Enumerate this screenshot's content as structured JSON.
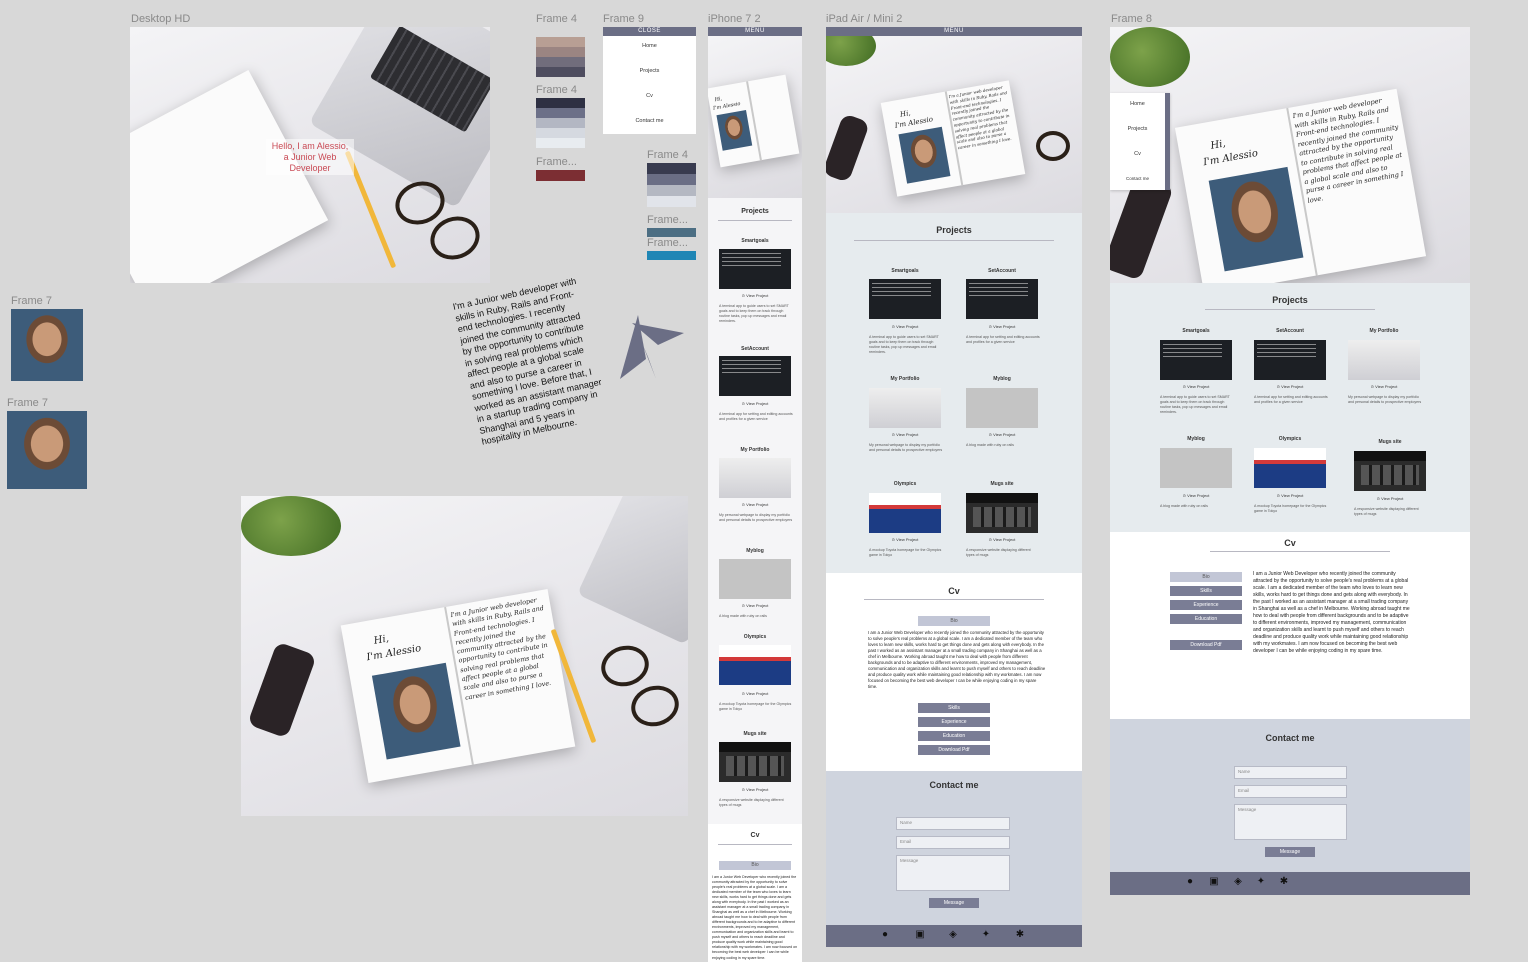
{
  "frames": {
    "desktop_hd": "Desktop HD",
    "frame4_a": "Frame 4",
    "frame4_b": "Frame 4",
    "frame4_c": "Frame 4",
    "frame_trunc_a": "Frame...",
    "frame_trunc_b": "Frame...",
    "frame_trunc_c": "Frame...",
    "frame9": "Frame 9",
    "iphone": "iPhone 7 2",
    "ipad": "iPad Air / Mini 2",
    "frame8": "Frame 8",
    "frame7_a": "Frame 7",
    "frame7_b": "Frame 7"
  },
  "colors": {
    "palette1": [
      "#b89f94",
      "#9b8582",
      "#716d7c",
      "#4e4d5f"
    ],
    "palette2": [
      "#2e3043",
      "#6c7088",
      "#b3b7c3",
      "#d5d9e0",
      "#e8ecf0"
    ],
    "palette3": [
      "#7c2e33"
    ],
    "palette4": [
      "#383b4f",
      "#6a6e85",
      "#b4b8c2",
      "#e1e4ea"
    ],
    "palette5": [
      "#4c6e83"
    ],
    "palette6": [
      "#1f86b5"
    ]
  },
  "hero": {
    "greeting": "Hello, I am Alessio, a Junior Web Developer",
    "hi": "Hi,",
    "name": "I'm Alessio",
    "notebook_text": "I'm a Junior web developer with skills in Ruby, Rails and Front-end technologies. I recently joined the community attracted by the opportunity to contribute in solving real problems that affect people at a global scale and also to purse a career in something I love."
  },
  "about_text": "I'm a Junior web developer with skills in Ruby, Rails and Front-end technologies. I recently joined the community attracted by the opportunity to contribute in solving real problems which affect people at a global scale and also to purse a career in something I love. Before that, I worked as an assistant manager in a startup trading company in Shanghai and 5 years in hospitality in Melbourne.",
  "menu": {
    "close": "CLOSE",
    "menu": "MENU",
    "items": [
      "Home",
      "Projects",
      "Cv",
      "Contact me"
    ]
  },
  "projects": {
    "title": "Projects",
    "view": "View Project",
    "items": [
      {
        "name": "Smartgoals",
        "desc": "A terminal app to guide users to set SMART goals and to keep them on track through routine tasks, pop up messages and email reminders."
      },
      {
        "name": "SetAccount",
        "desc": "A terminal app for setting and editing accounts and profiles for a given service"
      },
      {
        "name": "My Portfolio",
        "desc": "My personal webpage to display my portfolio and personal details to prospective employers"
      },
      {
        "name": "Myblog",
        "desc": "A blog made with ruby on rails"
      },
      {
        "name": "Olympics",
        "desc": "A mockup Toyota homepage for the Olympics game in Tokyo"
      },
      {
        "name": "Mugs site",
        "desc": "A responsive website displaying different types of mugs"
      }
    ]
  },
  "cv": {
    "title": "Cv",
    "tabs": [
      "Bio",
      "Skills",
      "Experience",
      "Education"
    ],
    "download": "Download Pdf",
    "bio": "I am a Junior Web Developer who recently joined the community attracted by the opportunity to solve people's real problems at a global scale. I am a dedicated member of the team who loves to learn new skills, works hard to get things done and gets along with everybody. In the past I worked as an assistant manager at a small trading company in Shanghai as well as a chef in Melbourne. Working abroad taught me how to deal with people from different backgrounds and to be adaptive to different environments, improved my management, communication and organization skills and learnt to push myself and others to reach deadline and produce quality work while maintaining good relationship with my workmates. I am now focused on becoming the best web developer I can be while enjoying coding in my spare time."
  },
  "contact": {
    "title": "Contact me",
    "name_ph": "Name",
    "email_ph": "Email",
    "message_ph": "Message",
    "submit": "Message"
  },
  "footer_icons": [
    "github-icon",
    "linkedin-icon",
    "codepen-icon",
    "twitter-icon",
    "slack-icon"
  ]
}
